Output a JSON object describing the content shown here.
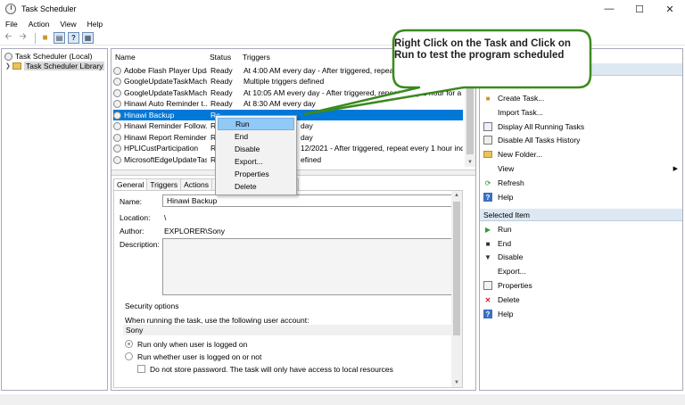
{
  "window": {
    "title": "Task Scheduler"
  },
  "menu": [
    "File",
    "Action",
    "View",
    "Help"
  ],
  "tree": {
    "root": "Task Scheduler (Local)",
    "library": "Task Scheduler Library"
  },
  "list": {
    "headers": {
      "name": "Name",
      "status": "Status",
      "triggers": "Triggers"
    },
    "rows": [
      {
        "name": "Adobe Flash Player Upda...",
        "status": "Ready",
        "triggers": "At 4:00 AM every day - After triggered, repeat every 1 hour for a duration of 1 day."
      },
      {
        "name": "GoogleUpdateTaskMachi...",
        "status": "Ready",
        "triggers": "Multiple triggers defined"
      },
      {
        "name": "GoogleUpdateTaskMachi...",
        "status": "Ready",
        "triggers": "At 10:05 AM every day - After triggered, repeat every 1 hour for a duratic"
      },
      {
        "name": "Hinawi Auto Reminder t...",
        "status": "Ready",
        "triggers": "At 8:30 AM every day"
      },
      {
        "name": "Hinawi Backup",
        "status": "Re",
        "triggers": ""
      },
      {
        "name": "Hinawi Reminder Follow...",
        "status": "Re",
        "triggers": "day"
      },
      {
        "name": "Hinawi Report Reminder",
        "status": "R",
        "triggers": "day"
      },
      {
        "name": "HPLICustParticipation",
        "status": "R",
        "triggers": "12/2021 - After triggered, repeat every 1 hour indefinit"
      },
      {
        "name": "MicrosoftEdgeUpdateTas...",
        "status": "R",
        "triggers": "efined"
      }
    ]
  },
  "tabs": [
    "General",
    "Triggers",
    "Actions",
    "Co",
    "ory"
  ],
  "general": {
    "name_label": "Name:",
    "name_value": "Hinawi Backup",
    "location_label": "Location:",
    "location_value": "\\",
    "author_label": "Author:",
    "author_value": "EXPLORER\\Sony",
    "description_label": "Description:",
    "security_title": "Security options",
    "account_text": "When running the task, use the following user account:",
    "account_value": "Sony",
    "radio1": "Run only when user is logged on",
    "radio2": "Run whether user is logged on or not",
    "check1": "Do not store password.  The task will only have access to local resources"
  },
  "context_menu": [
    "Run",
    "End",
    "Disable",
    "Export...",
    "Properties",
    "Delete"
  ],
  "actions": {
    "items1": [
      {
        "label": "Create Task...",
        "icon": "create-task-icon"
      },
      {
        "label": "Import Task...",
        "icon": "import-icon"
      },
      {
        "label": "Display All Running Tasks",
        "icon": "running-tasks-icon"
      },
      {
        "label": "Disable All Tasks History",
        "icon": "history-icon"
      },
      {
        "label": "New Folder...",
        "icon": "folder-icon"
      },
      {
        "label": "View",
        "icon": "view-icon"
      },
      {
        "label": "Refresh",
        "icon": "refresh-icon"
      },
      {
        "label": "Help",
        "icon": "help-icon"
      }
    ],
    "selected_header": "Selected Item",
    "items2": [
      {
        "label": "Run",
        "icon": "run-icon"
      },
      {
        "label": "End",
        "icon": "end-icon"
      },
      {
        "label": "Disable",
        "icon": "disable-icon"
      },
      {
        "label": "Export...",
        "icon": "export-icon"
      },
      {
        "label": "Properties",
        "icon": "properties-icon"
      },
      {
        "label": "Delete",
        "icon": "delete-icon"
      },
      {
        "label": "Help",
        "icon": "help-icon"
      }
    ]
  },
  "callout": {
    "text": "Right Click on the Task and Click on Run to test the program scheduled",
    "color": "#3a8a1e"
  },
  "colors": {
    "selection": "#0078d7",
    "menu_highlight": "#91c9f7",
    "actions_header": "#dde8f2"
  }
}
